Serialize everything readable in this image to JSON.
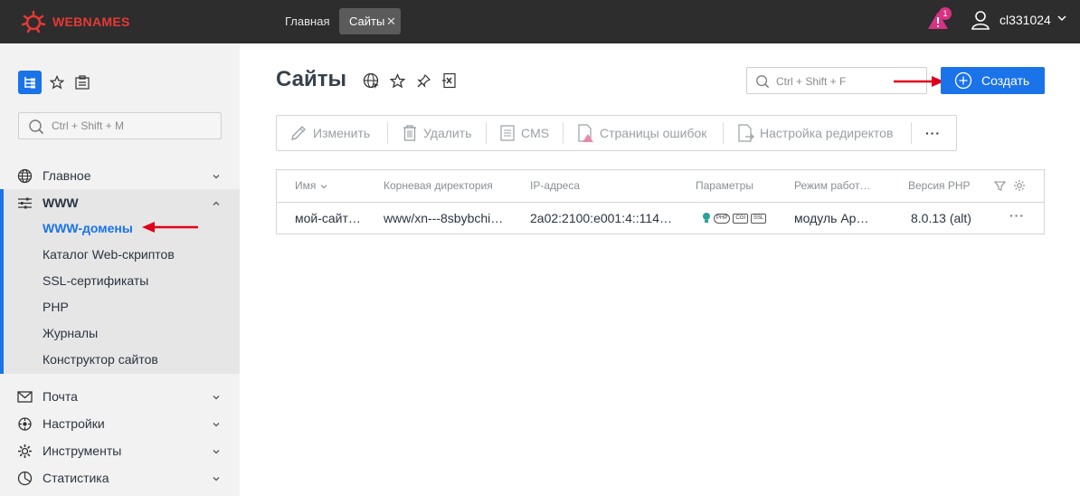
{
  "topbar": {
    "logo_text": "WEBNAMES",
    "tabs": [
      {
        "label": "Главная",
        "active": false
      },
      {
        "label": "Сайты",
        "active": true
      }
    ],
    "alert_count": "1",
    "username": "cl331024"
  },
  "sidebar": {
    "search_placeholder": "Ctrl + Shift + M",
    "menu": [
      {
        "label": "Главное",
        "icon": "globe-icon"
      },
      {
        "label": "WWW",
        "icon": "sliders-icon",
        "expanded": true
      },
      {
        "label": "Почта",
        "icon": "mail-icon"
      },
      {
        "label": "Настройки",
        "icon": "settings-icon"
      },
      {
        "label": "Инструменты",
        "icon": "gear-icon"
      },
      {
        "label": "Статистика",
        "icon": "pie-chart-icon"
      }
    ],
    "www_items": [
      "WWW-домены",
      "Каталог Web-скриптов",
      "SSL-сертификаты",
      "PHP",
      "Журналы",
      "Конструктор сайтов"
    ]
  },
  "main": {
    "title": "Сайты",
    "search_placeholder": "Ctrl + Shift + F",
    "create_label": "Создать",
    "toolbar": [
      "Изменить",
      "Удалить",
      "CMS",
      "Страницы ошибок",
      "Настройка редиректов"
    ],
    "more": "···",
    "table": {
      "headers": [
        "Имя",
        "Корневая директория",
        "IP-адреса",
        "Параметры",
        "Режим работ…",
        "Версия PHP"
      ],
      "rows": [
        {
          "name": "мой-сайт…",
          "root": "www/xn---8sbybchi…",
          "ip": "2a02:2100:e001:4::114…",
          "params": [
            "PHP",
            "CGI",
            "SSL"
          ],
          "mode": "модуль Ap…",
          "php": "8.0.13 (alt)",
          "actions": "···"
        }
      ]
    }
  },
  "colors": {
    "accent": "#1a73e8",
    "brand": "#e53935",
    "arrow": "#e0001b",
    "topbar": "#2d2d2d"
  }
}
